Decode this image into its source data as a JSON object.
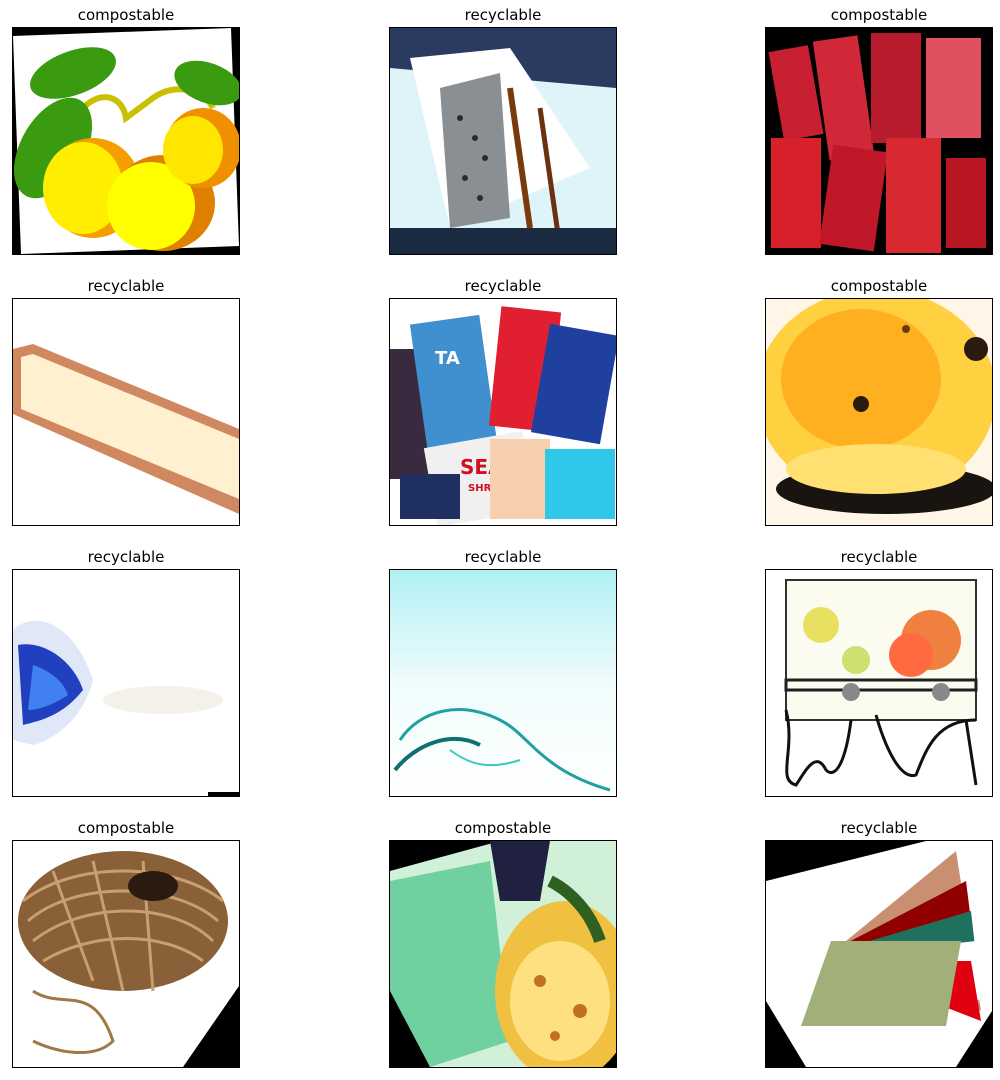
{
  "figure": {
    "panels": [
      {
        "title": "compostable",
        "subject": "fruit-illustration"
      },
      {
        "title": "recyclable",
        "subject": "metal-grater"
      },
      {
        "title": "compostable",
        "subject": "raw-meat"
      },
      {
        "title": "recyclable",
        "subject": "wooden-tray"
      },
      {
        "title": "recyclable",
        "subject": "magazines"
      },
      {
        "title": "compostable",
        "subject": "yellow-fruit"
      },
      {
        "title": "recyclable",
        "subject": "plastic-bag"
      },
      {
        "title": "recyclable",
        "subject": "cyan-plastic"
      },
      {
        "title": "recyclable",
        "subject": "drink-dispenser"
      },
      {
        "title": "compostable",
        "subject": "twine-ball"
      },
      {
        "title": "compostable",
        "subject": "food-closeup"
      },
      {
        "title": "recyclable",
        "subject": "paper-envelopes"
      }
    ],
    "print_labels": {
      "magazine_1": "TA",
      "magazine_2": "SEA",
      "magazine_3": "SHRI"
    }
  }
}
